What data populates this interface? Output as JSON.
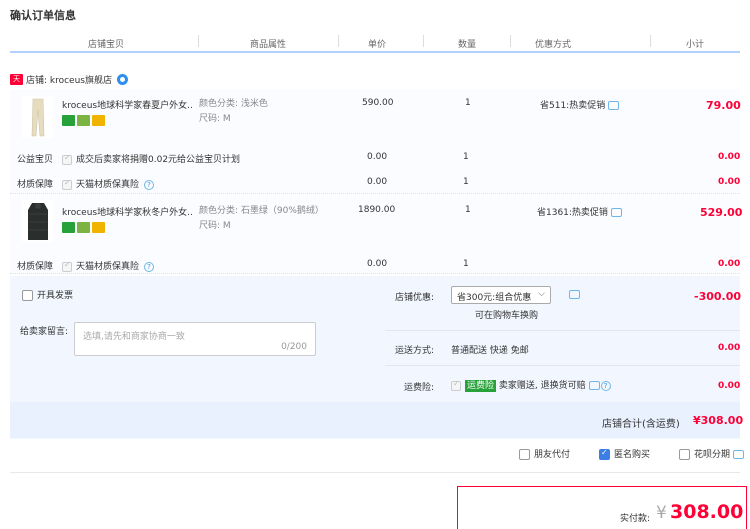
{
  "page_title": "确认订单信息",
  "columns": [
    "店铺宝贝",
    "商品属性",
    "单价",
    "数量",
    "优惠方式",
    "小计"
  ],
  "shop": {
    "badge": "天猫",
    "label": "店铺: kroceus旗舰店"
  },
  "items": [
    {
      "name": "kroceus地球科学家春夏户外女...",
      "attr1": "颜色分类: 浅米色",
      "attr2": "尺码: M",
      "price": "590.00",
      "qty": "1",
      "promo": "省511:热卖促销",
      "subtotal": "79.00",
      "extras": [
        {
          "label": "公益宝贝",
          "desc": "成交后卖家将捐赠0.02元给公益宝贝计划",
          "price": "0.00",
          "qty": "1",
          "subtotal": "0.00"
        },
        {
          "label": "材质保障",
          "desc": "天猫材质保真险",
          "price": "0.00",
          "qty": "1",
          "subtotal": "0.00"
        }
      ]
    },
    {
      "name": "kroceus地球科学家秋冬户外女...",
      "attr1": "颜色分类: 石墨绿（90%鹅绒）",
      "attr2": "尺码: M",
      "price": "1890.00",
      "qty": "1",
      "promo": "省1361:热卖促销",
      "subtotal": "529.00",
      "extras": [
        {
          "label": "材质保障",
          "desc": "天猫材质保真险",
          "price": "0.00",
          "qty": "1",
          "subtotal": "0.00"
        }
      ]
    }
  ],
  "invoice_label": "开具发票",
  "message": {
    "label": "给卖家留言:",
    "placeholder": "选填,请先和商家协商一致",
    "counter": "0/200"
  },
  "shop_discount": {
    "label": "店铺优惠:",
    "selected": "省300元:组合优惠",
    "note": "可在购物车换购",
    "amount": "-300.00"
  },
  "shipping": {
    "label": "运送方式:",
    "value": "普通配送 快递 免邮",
    "amount": "0.00"
  },
  "freight_insurance": {
    "label": "运费险:",
    "tag": "运费险",
    "desc": "卖家赠送, 退换货可赔",
    "amount": "0.00"
  },
  "shop_total": {
    "label": "店铺合计(含运费)",
    "amount": "¥308.00"
  },
  "options": {
    "friend_pay": "朋友代付",
    "anonymous": "匿名购买",
    "huabei": "花呗分期"
  },
  "payment": {
    "label": "实付款:",
    "currency": "¥",
    "amount": "308.00"
  },
  "colors": {
    "price_red": "#ff0036",
    "header_line": "#b2d1ff",
    "option_bg": "#f2f7ff"
  }
}
